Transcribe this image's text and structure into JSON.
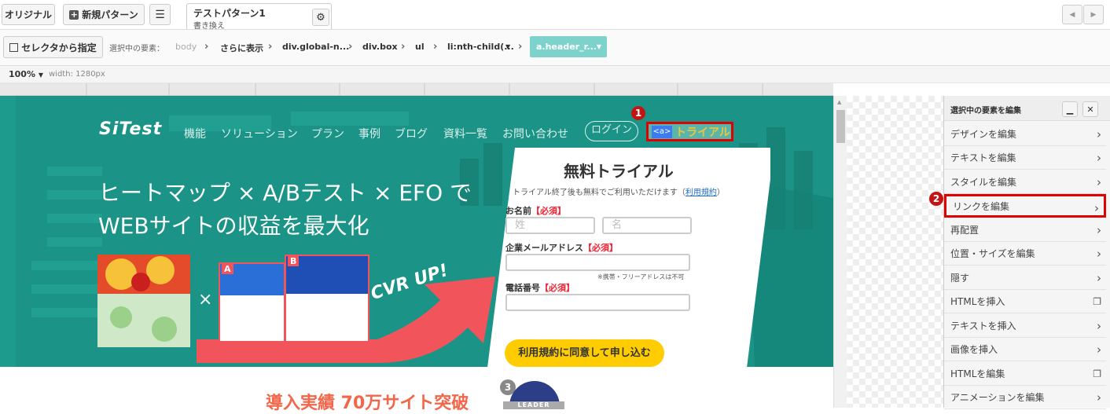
{
  "toolbar": {
    "original_label": "オリジナル",
    "new_pattern_label": "新規パターン",
    "tab": {
      "title": "テストパターン1",
      "subtitle": "書き換え"
    }
  },
  "selector_bar": {
    "button_label": "セレクタから指定",
    "selected_label": "選択中の要素：",
    "crumbs": [
      "body",
      "さらに表示",
      "div.global-n...",
      "div.box",
      "ul",
      "li:nth-child(...",
      "a.header_r..."
    ]
  },
  "viewbar": {
    "zoom": "100%",
    "width": "width: 1280px"
  },
  "site": {
    "logo": "SiTest",
    "nav": [
      "機能",
      "ソリューション",
      "プラン",
      "事例",
      "ブログ",
      "資料一覧",
      "お問い合わせ"
    ],
    "login": "ログイン",
    "tag": "<a>",
    "trial": "トライアル",
    "headline1": "ヒートマップ × A/Bテスト × EFO で",
    "headline2": "WEBサイトの収益を最大化",
    "cvr": "CVR UP!",
    "times": "×",
    "ab_a": "A",
    "ab_b": "B",
    "form_title": "無料トライアル",
    "form_note": "トライアル終了後も無料でご利用いただけます（",
    "terms_link": "利用規約",
    "note_close": "）",
    "name_label": "お名前",
    "required": "【必須】",
    "last_ph": "姓",
    "first_ph": "名",
    "email_label": "企業メールアドレス",
    "email_note": "※携帯・フリーアドレスは不可",
    "phone_label": "電話番号",
    "submit": "利用規約に同意して申し込む",
    "results": "導入実績 70万サイト突破",
    "leader_num": "3",
    "leader": "LEADER"
  },
  "panel": {
    "title": "選択中の要素を編集",
    "items": [
      "デザインを編集",
      "テキストを編集",
      "スタイルを編集",
      "リンクを編集",
      "再配置",
      "位置・サイズを編集",
      "隠す",
      "HTMLを挿入",
      "テキストを挿入",
      "画像を挿入",
      "HTMLを編集",
      "アニメーションを編集"
    ]
  },
  "annotations": {
    "badge1": "1",
    "badge2": "2"
  },
  "colors": {
    "hero": "#1d9b8c",
    "highlight": "#e00000",
    "accent": "#7dd3cb",
    "submit": "#ffcc00"
  }
}
